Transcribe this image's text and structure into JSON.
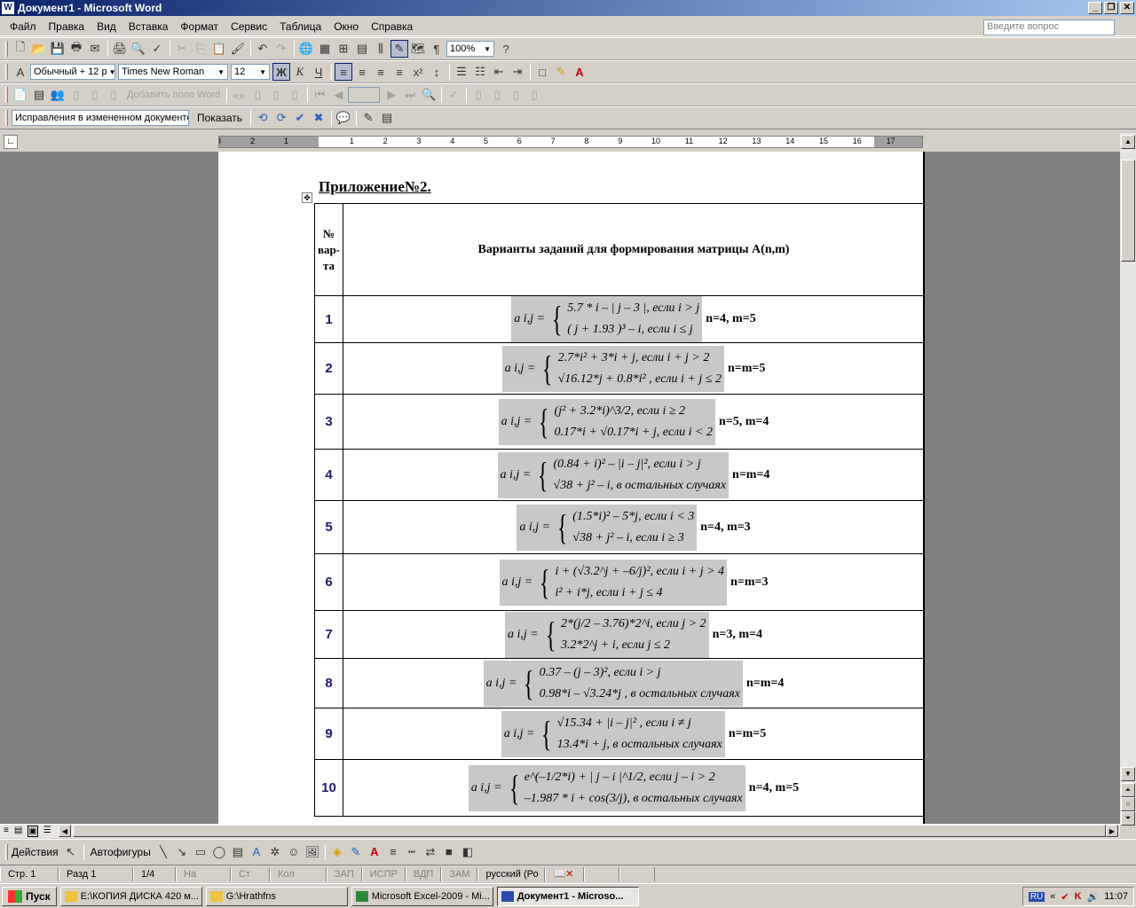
{
  "window": {
    "title": "Документ1 - Microsoft Word",
    "app_icon": "W"
  },
  "menu": [
    "Файл",
    "Правка",
    "Вид",
    "Вставка",
    "Формат",
    "Сервис",
    "Таблица",
    "Окно",
    "Справка"
  ],
  "ask_placeholder": "Введите вопрос",
  "toolbar": {
    "zoom": "100%",
    "style": "Обычный + 12 p",
    "font": "Times New Roman",
    "size": "12",
    "bold": "Ж",
    "italic": "К",
    "underline": "Ч",
    "add_field": "Добавить поле Word",
    "track_mode": "Исправления в измененном документе",
    "show": "Показать"
  },
  "ruler": {
    "labels": [
      "3",
      "2",
      "1",
      "1",
      "2",
      "3",
      "4",
      "5",
      "6",
      "7",
      "8",
      "9",
      "10",
      "11",
      "12",
      "13",
      "14",
      "15",
      "16",
      "17"
    ]
  },
  "doc": {
    "heading": "Приложение№2.",
    "header_num": [
      "№",
      "вар-",
      "та"
    ],
    "header_title": "Варианты заданий для формирования  матрицы А(n,m)",
    "rows": [
      {
        "n": "1",
        "lhs": "a i,j =",
        "l1": "5.7 * i – | j – 3 |,      если       i  >  j",
        "l2": "( j + 1.93 )³ – i,       если       i  ≤  j",
        "nm": "n=4, m=5"
      },
      {
        "n": "2",
        "lhs": "a i,j =",
        "l1": "2.7*i² + 3*i + j,   если   i + j > 2",
        "l2": "√16.12*j + 0.8*i² ,   если   i + j ≤ 2",
        "nm": "n=m=5"
      },
      {
        "n": "3",
        "lhs": "a i,j =",
        "l1": "(j² + 3.2*i)^3/2,   если   i ≥ 2",
        "l2": "0.17*i + √0.17*i + j,   если   i < 2",
        "nm": "n=5, m=4"
      },
      {
        "n": "4",
        "lhs": "a i,j =",
        "l1": "(0.84 + i)² – |i – j|²,   если   i > j",
        "l2": "√38 + j² – i,   в остальных случаях",
        "nm": "n=m=4"
      },
      {
        "n": "5",
        "lhs": "a i,j =",
        "l1": "(1.5*i)² – 5*j,   если   i < 3",
        "l2": "√38 + j² – i,   если   i ≥ 3",
        "nm": "n=4, m=3"
      },
      {
        "n": "6",
        "lhs": "a i,j =",
        "l1": "i + (√3.2^j + –6/j)²,   если   i + j > 4",
        "l2": "i² + i*j,                если   i + j ≤ 4",
        "nm": "n=m=3"
      },
      {
        "n": "7",
        "lhs": "a i,j =",
        "l1": "2*(j/2 – 3.76)*2^i,   если   j > 2",
        "l2": "3.2*2^j + i,              если   j ≤ 2",
        "nm": "n=3, m=4"
      },
      {
        "n": "8",
        "lhs": "a i,j =",
        "l1": "0.37 – (j – 3)²,   если   i > j",
        "l2": "0.98*i – √3.24*j ,   в остальных случаях",
        "nm": "n=m=4"
      },
      {
        "n": "9",
        "lhs": "a i,j =",
        "l1": "√15.34 + |i – j|² ,   если   i ≠ j",
        "l2": "13.4*i + j,             в остальных случаях",
        "nm": "n=m=5"
      },
      {
        "n": "10",
        "lhs": "a i,j =",
        "l1": "e^(–1/2*i) + | j – i |^1/2,   если   j – i > 2",
        "l2": "–1.987 * i + cos(3/j),   в остальных   случаях",
        "nm": "n=4, m=5"
      }
    ]
  },
  "status": {
    "page": "Стр. 1",
    "section": "Разд 1",
    "pages": "1/4",
    "at": "На",
    "line": "Ст",
    "col": "Кол",
    "rec": "ЗАП",
    "trk": "ИСПР",
    "ext": "ВДП",
    "ovr": "ЗАМ",
    "lang": "русский (Ро"
  },
  "drawbar": {
    "actions": "Действия",
    "autoshapes": "Автофигуры"
  },
  "taskbar": {
    "start": "Пуск",
    "tasks": [
      "E:\\КОПИЯ ДИСКА 420 м...",
      "G:\\Hrathfns",
      "Microsoft Excel-2009 - Mi...",
      "Документ1 - Microso..."
    ],
    "lang": "RU",
    "clock": "11:07"
  },
  "colors": {
    "titlebar": "#0a246a",
    "accent_num": "#1a1a6e"
  }
}
